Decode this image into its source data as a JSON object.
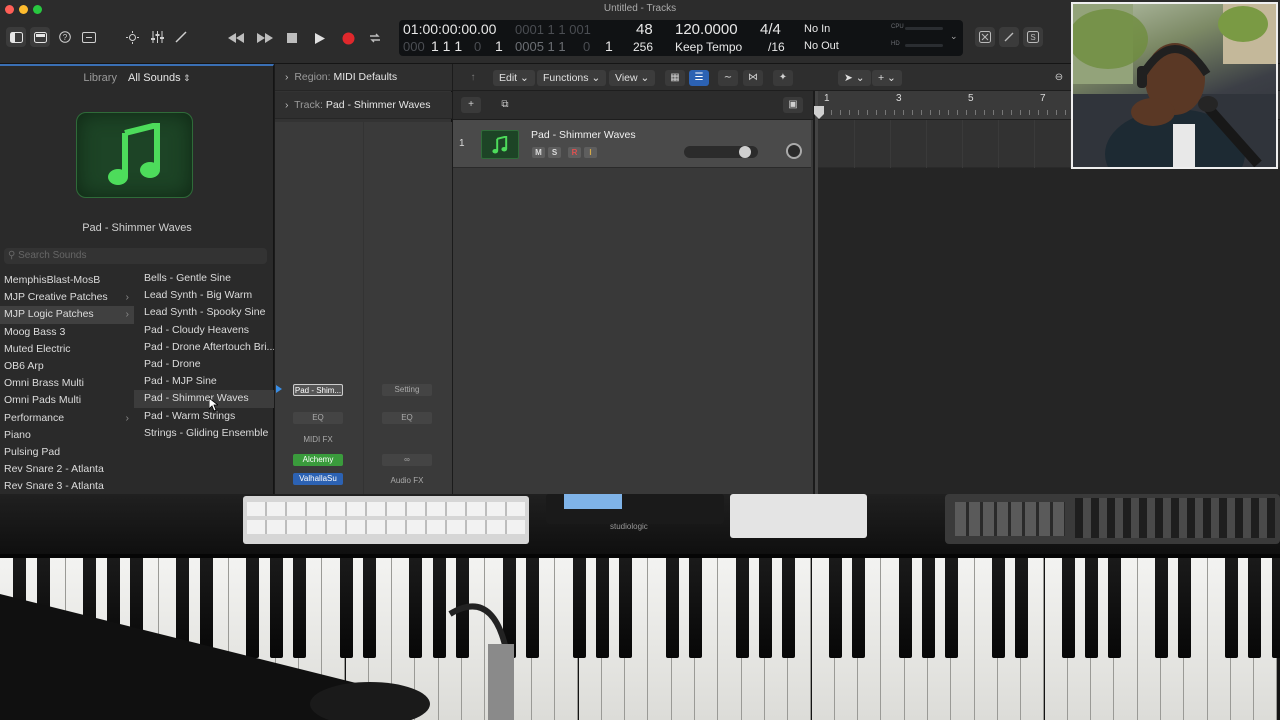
{
  "window": {
    "title": "Untitled - Tracks"
  },
  "lcd": {
    "position_time": "01:00:00:00.00",
    "position_bars_dim": "0001 1 1 001",
    "position_bars": "1 1 1",
    "position_bars_tail": "1",
    "position_bars2_prefix": "0005 1 1",
    "position_bars2_tail": "1",
    "bar": "48",
    "beat": "256",
    "tempo": "120.0000",
    "tempo_mode": "Keep Tempo",
    "signature": "4/4",
    "division": "/16",
    "midi_in": "No In",
    "midi_out": "No Out",
    "cpu_label": "CPU",
    "hd_label": "HD"
  },
  "library": {
    "label": "Library",
    "filter": "All Sounds",
    "patch_name": "Pad - Shimmer Waves",
    "search_placeholder": "Search Sounds",
    "categories": [
      {
        "label": "MemphisBlast-MosB",
        "sub": false
      },
      {
        "label": "MJP Creative Patches",
        "sub": true
      },
      {
        "label": "MJP Logic Patches",
        "sub": true
      },
      {
        "label": "Moog Bass 3",
        "sub": false
      },
      {
        "label": "Muted Electric",
        "sub": false
      },
      {
        "label": "OB6 Arp",
        "sub": false
      },
      {
        "label": "Omni Brass Multi",
        "sub": false
      },
      {
        "label": "Omni Pads Multi",
        "sub": false
      },
      {
        "label": "Performance",
        "sub": true
      },
      {
        "label": "Piano",
        "sub": false
      },
      {
        "label": "Pulsing Pad",
        "sub": false
      },
      {
        "label": "Rev Snare 2 - Atlanta",
        "sub": false
      },
      {
        "label": "Rev Snare 3 - Atlanta",
        "sub": false
      }
    ],
    "patches": [
      "Bells - Gentle Sine",
      "Lead Synth - Big Warm",
      "Lead Synth - Spooky Sine",
      "Pad - Cloudy Heavens",
      "Pad - Drone Aftertouch Bri...",
      "Pad - Drone",
      "Pad - MJP Sine",
      "Pad - Shimmer Waves",
      "Pad - Warm Strings",
      "Strings - Gliding Ensemble"
    ]
  },
  "inspector": {
    "region_label": "Region:",
    "region_value": "MIDI Defaults",
    "track_label": "Track:",
    "track_value": "Pad - Shimmer Waves",
    "strip1": {
      "setting": "Pad - Shim...",
      "eq": "EQ",
      "midi_fx": "MIDI FX",
      "instrument": "Alchemy",
      "effect": "ValhallaSu"
    },
    "strip2": {
      "setting": "Setting",
      "eq": "EQ",
      "link": "∞",
      "audio_fx": "Audio FX"
    }
  },
  "toolbar": {
    "edit": "Edit",
    "functions": "Functions",
    "view": "View"
  },
  "track": {
    "number": "1",
    "name": "Pad - Shimmer Waves",
    "mute": "M",
    "solo": "S",
    "record": "R",
    "input": "I",
    "volume_level": 0.88
  },
  "ruler": {
    "bars": [
      "1",
      "3",
      "5",
      "7"
    ]
  },
  "hardware": {
    "brand": "studiologic"
  },
  "colors": {
    "accent": "#2c62b3",
    "patch_green": "#4ddc5b",
    "alchemy": "#3a9b3c",
    "valhalla": "#2c62b3",
    "record": "#e0282c"
  }
}
